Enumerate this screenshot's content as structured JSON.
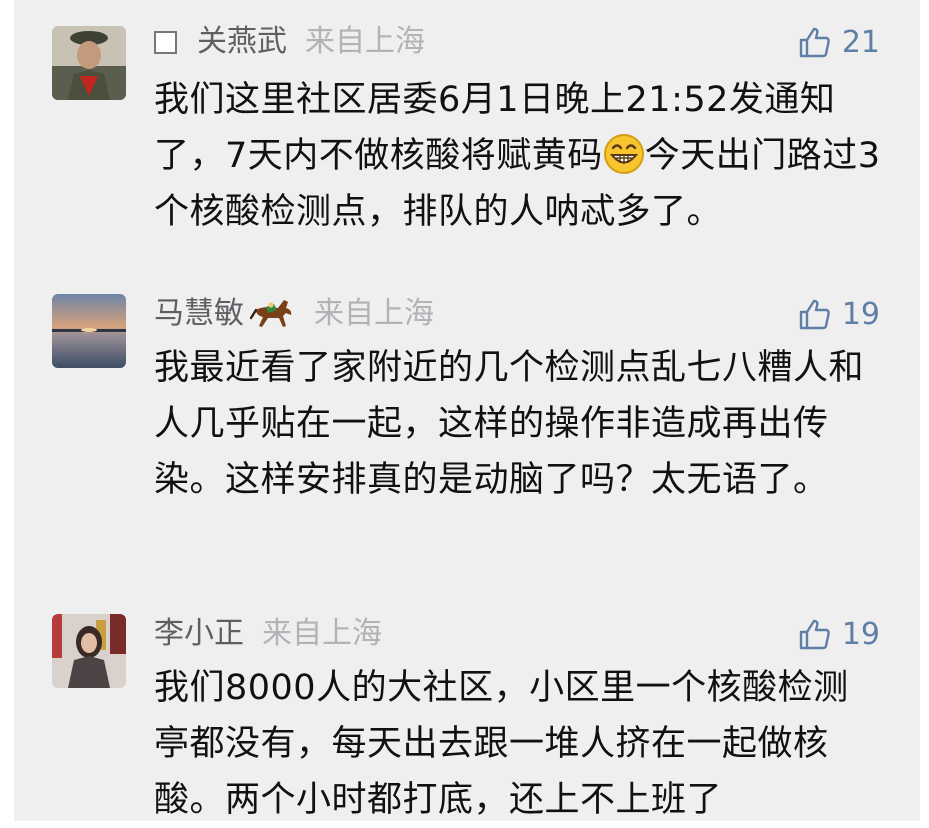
{
  "comments": [
    {
      "name": "关燕武",
      "location": "来自上海",
      "likes": "21",
      "text_part1": "我们这里社区居委6月1日晚上21:52发通知了，7天内不做核酸将赋黄码",
      "emoji": "grinning-face-emoji",
      "text_part2": "今天出门路过3个核酸检测点，排队的人呐忒多了。"
    },
    {
      "name": "马慧敏",
      "name_icon": "horse-emoji",
      "location": "来自上海",
      "likes": "19",
      "text": "我最近看了家附近的几个检测点乱七八糟人和人几乎贴在一起，这样的操作非造成再出传染。这样安排真的是动脑了吗？太无语了。"
    },
    {
      "name": "李小正",
      "location": "来自上海",
      "likes": "19",
      "text": "我们8000人的大社区，小区里一个核酸检测亭都没有，每天出去跟一堆人挤在一起做核酸。两个小时都打底，还上不上班了"
    }
  ],
  "colors": {
    "background": "#efeff0",
    "name": "#5f5f63",
    "location": "#b3b3b7",
    "like": "#5f7fa6",
    "text": "#111111"
  },
  "icons": {
    "like": "thumbs-up-icon",
    "checkbox": "checkbox-icon"
  }
}
